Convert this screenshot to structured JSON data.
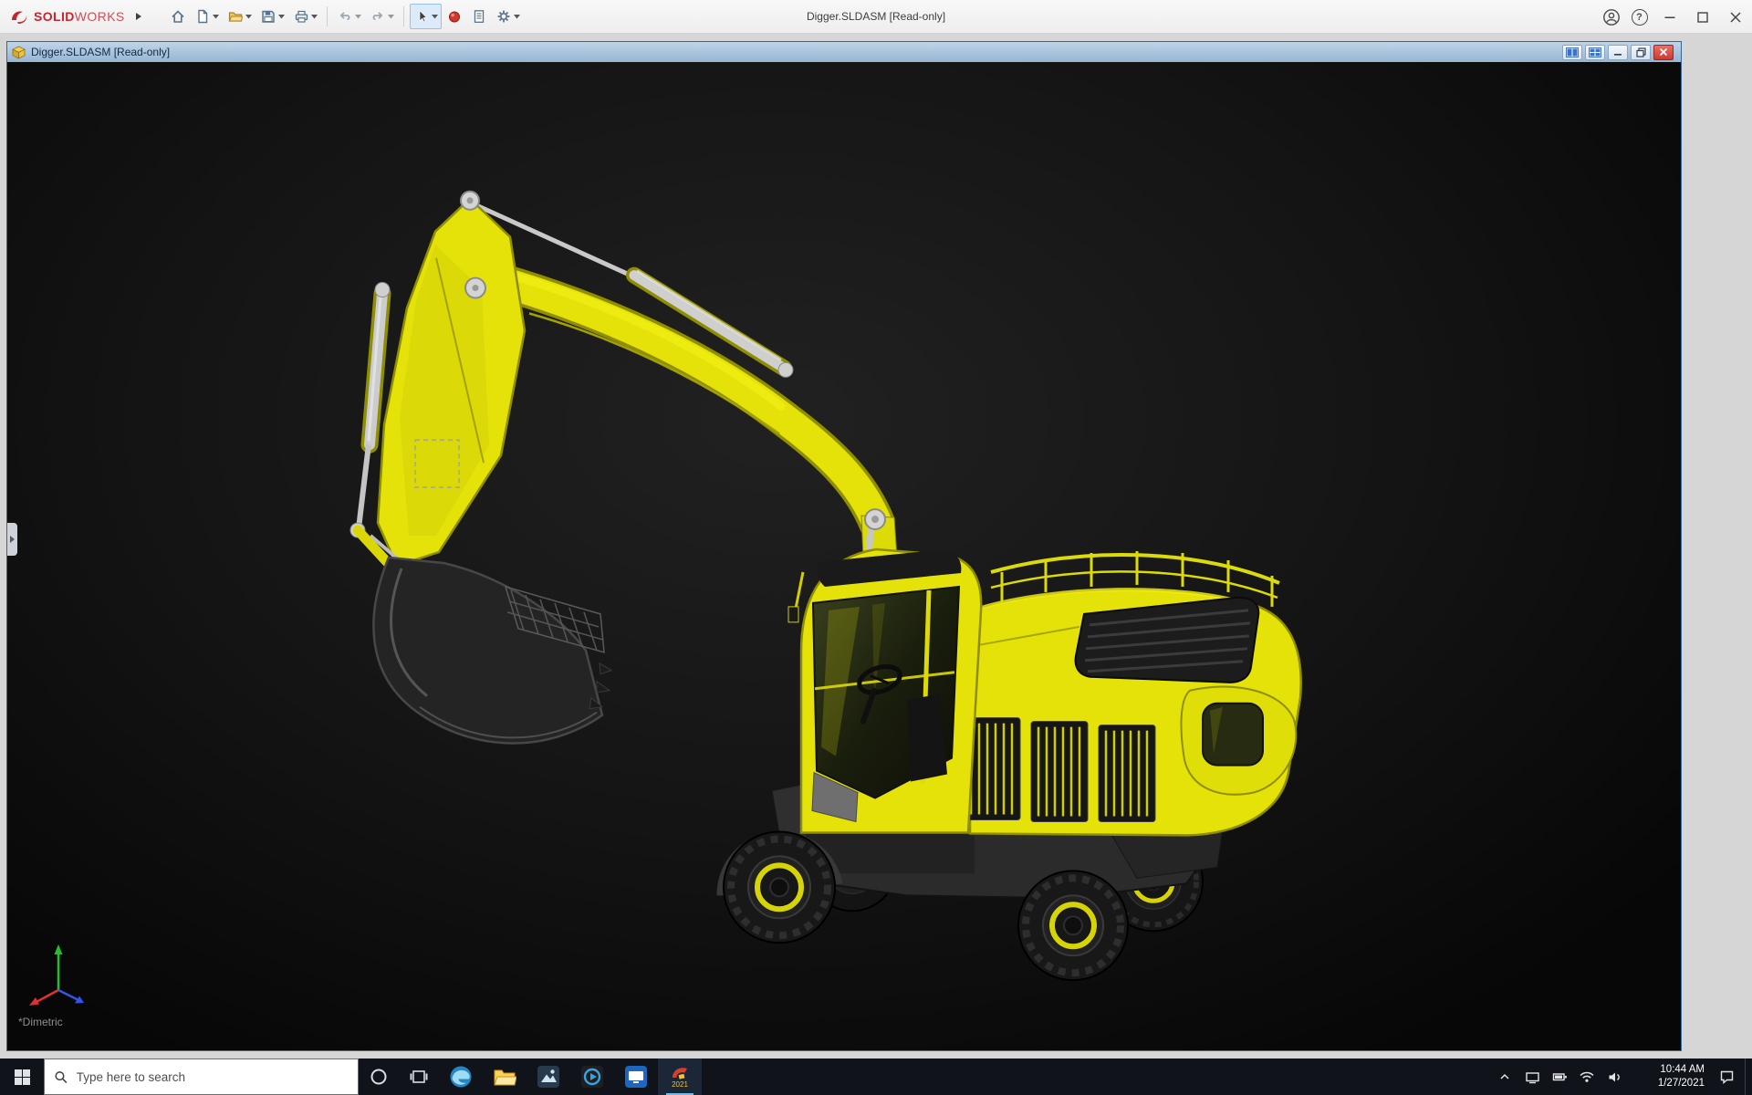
{
  "app": {
    "brand_bold": "SOLID",
    "brand_light": "WORKS",
    "title": "Digger.SLDASM [Read-only]",
    "help_glyph": "?"
  },
  "doc": {
    "title": "Digger.SLDASM [Read-only]"
  },
  "viewport": {
    "orientation": "*Dimetric"
  },
  "taskbar": {
    "search_placeholder": "Type here to search",
    "solidworks_year": "2021",
    "time": "10:44 AM",
    "date": "1/27/2021"
  },
  "colors": {
    "excavator_yellow": "#e4e208",
    "excavator_dark": "#242424",
    "hydraulic_silver": "#cccccc",
    "brand_red": "#c8242e",
    "doc_titlebar_blue": "#a5c0dc",
    "doc_border_blue": "#37689a",
    "viewport_bg": "#141414",
    "taskbar_bg": "#10141a",
    "close_red": "#cc3a2f",
    "active_underline": "#76b9ed"
  }
}
